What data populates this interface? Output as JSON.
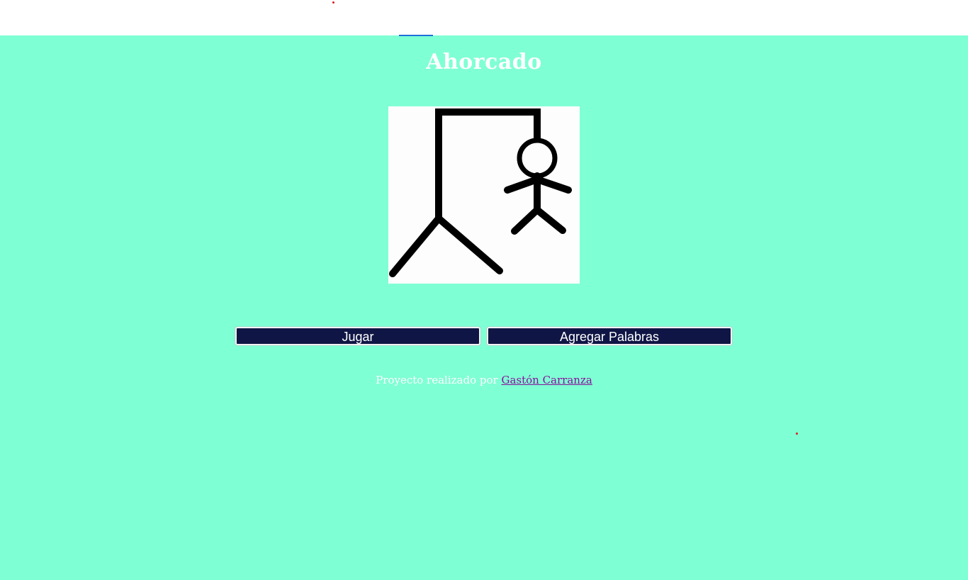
{
  "page": {
    "title": "Ahorcado",
    "background_color": "#7fffd4",
    "header_color": "#ffffff"
  },
  "hangman_image": {
    "icon": "hangman-figure",
    "stroke_color": "#000000"
  },
  "buttons": {
    "play_label": "Jugar",
    "add_words_label": "Agregar Palabras",
    "color": "#0f1645"
  },
  "footer": {
    "text": "Proyecto realizado por ",
    "author_link": "Gastón Carranza",
    "link_color": "#8a0e9c"
  }
}
